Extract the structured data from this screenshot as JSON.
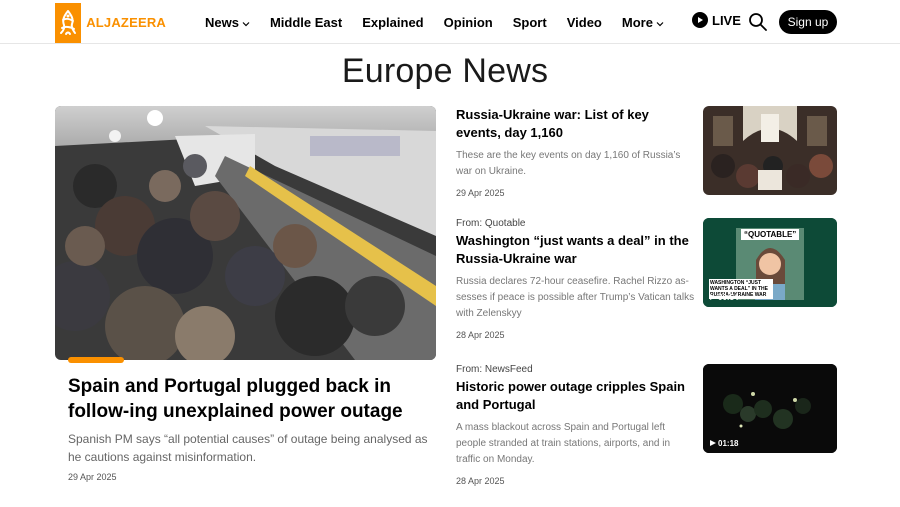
{
  "header": {
    "logo_text": "ALJAZEERA",
    "nav": [
      {
        "label": "News",
        "dropdown": true
      },
      {
        "label": "Middle East",
        "dropdown": false
      },
      {
        "label": "Explained",
        "dropdown": false
      },
      {
        "label": "Opinion",
        "dropdown": false
      },
      {
        "label": "Sport",
        "dropdown": false
      },
      {
        "label": "Video",
        "dropdown": false
      },
      {
        "label": "More",
        "dropdown": true
      }
    ],
    "live_label": "LIVE",
    "signup_label": "Sign up"
  },
  "page_title": "Europe News",
  "hero": {
    "title": "Spain and Portugal plugged back in follow-ing unexplained power outage",
    "summary": "Spanish PM says “all potential causes” of outage being analysed as he cautions against misinformation.",
    "date": "29 Apr 2025"
  },
  "items": [
    {
      "source": "",
      "title": "Russia-Ukraine war: List of key events, day 1,160",
      "summary": "These are the key events on day 1,160 of Russia’s war on Ukraine.",
      "date": "29 Apr 2025",
      "thumb_badge": ""
    },
    {
      "source": "From: Quotable",
      "title": "Washington “just wants a deal” in the Russia-Ukraine war",
      "summary": "Russia declares 72-hour ceasefire. Rachel Rizzo as-sesses if peace is possible after Trump’s Vatican talks with Zelenskyy",
      "date": "28 Apr 2025",
      "thumb_badge": "00:54",
      "thumb_label": "“QUOTABLE”",
      "thumb_caption": "WASHINGTON “JUST WANTS A DEAL” IN THE RUSSIA-UKRAINE WAR"
    },
    {
      "source": "From: NewsFeed",
      "title": "Historic power outage cripples Spain and Portugal",
      "summary": "A mass blackout across Spain and Portugal left people stranded at train stations, airports, and in traffic on Monday.",
      "date": "28 Apr 2025",
      "thumb_badge": "01:18"
    }
  ],
  "colors": {
    "brand": "#fa9000",
    "text": "#000000",
    "muted": "#666666"
  },
  "icons": {
    "live": "play-circle-icon",
    "search": "search-icon",
    "chevron": "chevron-down-icon"
  }
}
